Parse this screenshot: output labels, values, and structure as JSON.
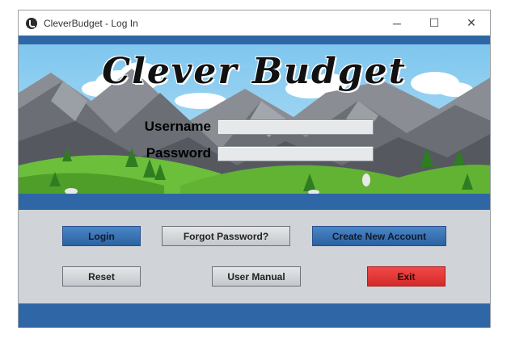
{
  "window": {
    "title": "CleverBudget - Log In"
  },
  "window_controls": {
    "minimize": "─",
    "maximize": "☐",
    "close": "✕"
  },
  "banner": {
    "logo_text": "Clever Budget"
  },
  "form": {
    "username_label": "Username",
    "password_label": "Password",
    "username_value": "",
    "password_value": ""
  },
  "buttons": {
    "login": "Login",
    "forgot_password": "Forgot Password?",
    "create_account": "Create New Account",
    "reset": "Reset",
    "user_manual": "User Manual",
    "exit": "Exit"
  },
  "colors": {
    "accent_blue": "#2f67a6",
    "exit_red": "#e23a3a",
    "panel_grey": "#d0d3d8"
  }
}
